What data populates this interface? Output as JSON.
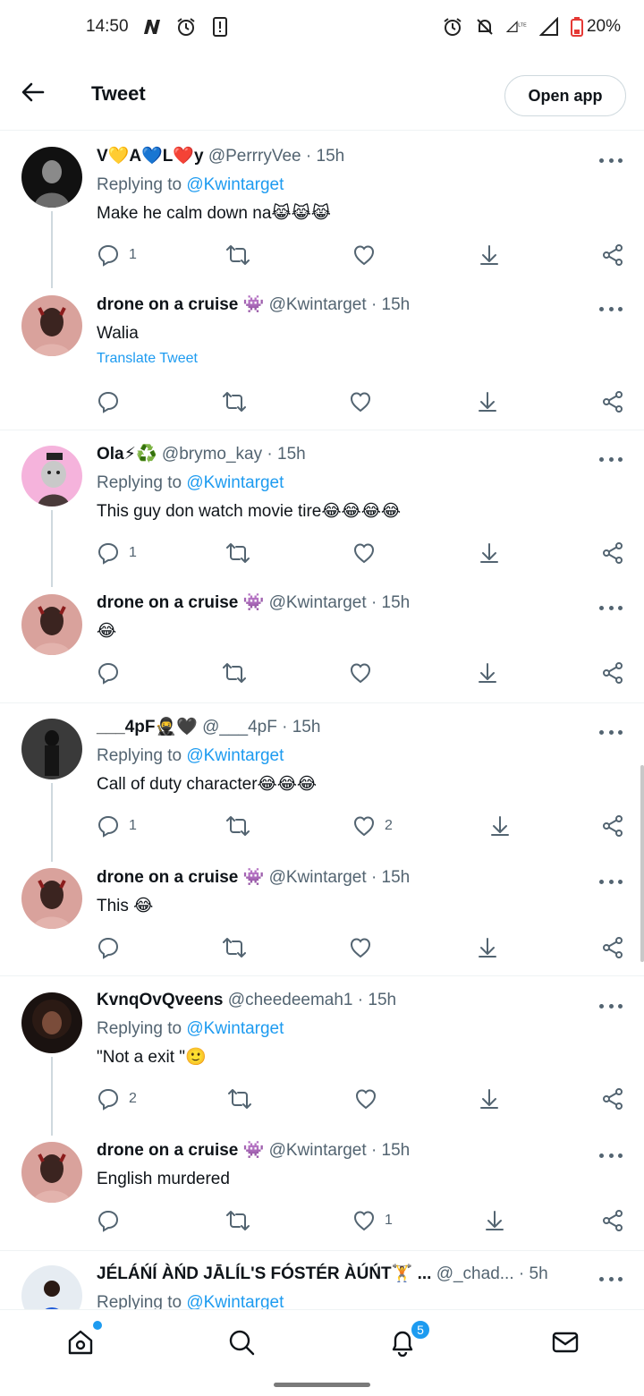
{
  "status_bar": {
    "time": "14:50",
    "battery": "20%"
  },
  "header": {
    "title": "Tweet",
    "open_app": "Open app"
  },
  "tweets": [
    {
      "name": "V💛A💙L❤️y",
      "handle": "@PerrryVee",
      "time": "· 15h",
      "replying_label": "Replying to",
      "replying_to": "@Kwintarget",
      "text": "Make he calm down na😹😹😹",
      "replies": "1",
      "retweets": "",
      "likes": "",
      "avatar_color": "#1e1e1e"
    },
    {
      "name": "drone on a cruise 👾",
      "handle": "@Kwintarget",
      "time": "· 15h",
      "text": "Walia",
      "translate": "Translate Tweet",
      "replies": "",
      "retweets": "",
      "likes": "",
      "avatar_color": "#c98a86"
    },
    {
      "name": "Ola⚡♻️",
      "handle": "@brymo_kay",
      "time": "· 15h",
      "replying_label": "Replying to",
      "replying_to": "@Kwintarget",
      "text": "This guy don watch movie tire😂😂😂😂",
      "replies": "1",
      "retweets": "",
      "likes": "",
      "avatar_color": "#f2a6d6"
    },
    {
      "name": "drone on a cruise 👾",
      "handle": "@Kwintarget",
      "time": "· 15h",
      "text": "😂",
      "replies": "",
      "retweets": "",
      "likes": "",
      "avatar_color": "#c98a86"
    },
    {
      "name": "___4pF🥷🖤",
      "handle": "@___4pF",
      "time": "· 15h",
      "replying_label": "Replying to",
      "replying_to": "@Kwintarget",
      "text": "Call of duty character😂😂😂",
      "replies": "1",
      "retweets": "",
      "likes": "2",
      "avatar_color": "#2a2a2a"
    },
    {
      "name": "drone on a cruise 👾",
      "handle": "@Kwintarget",
      "time": "· 15h",
      "text": "This 😂",
      "replies": "",
      "retweets": "",
      "likes": "",
      "avatar_color": "#c98a86"
    },
    {
      "name": "KvnqOvQveens",
      "handle": "@cheedeemah1",
      "time": "· 15h",
      "replying_label": "Replying to",
      "replying_to": "@Kwintarget",
      "text": "\"Not a exit \"🙂",
      "replies": "2",
      "retweets": "",
      "likes": "",
      "avatar_color": "#3a2418"
    },
    {
      "name": "drone on a cruise 👾",
      "handle": "@Kwintarget",
      "time": "· 15h",
      "text": "English murdered",
      "replies": "",
      "retweets": "",
      "likes": "1",
      "avatar_color": "#c98a86"
    },
    {
      "name": "JÉLÁŃÍ ÀŃD JĀLÍL'S FÓSTÉR ÀÚŃT🏋️ ...",
      "handle": "@_chad...",
      "time": "· 5h",
      "replying_label": "Replying to",
      "replying_to": "@Kwintarget",
      "avatar_color": "#dfe6ee"
    }
  ],
  "bottom_nav": {
    "notifications_badge": "5"
  },
  "colors": {
    "accent": "#1d9bf0",
    "text": "#0f1419",
    "secondary": "#536471"
  }
}
